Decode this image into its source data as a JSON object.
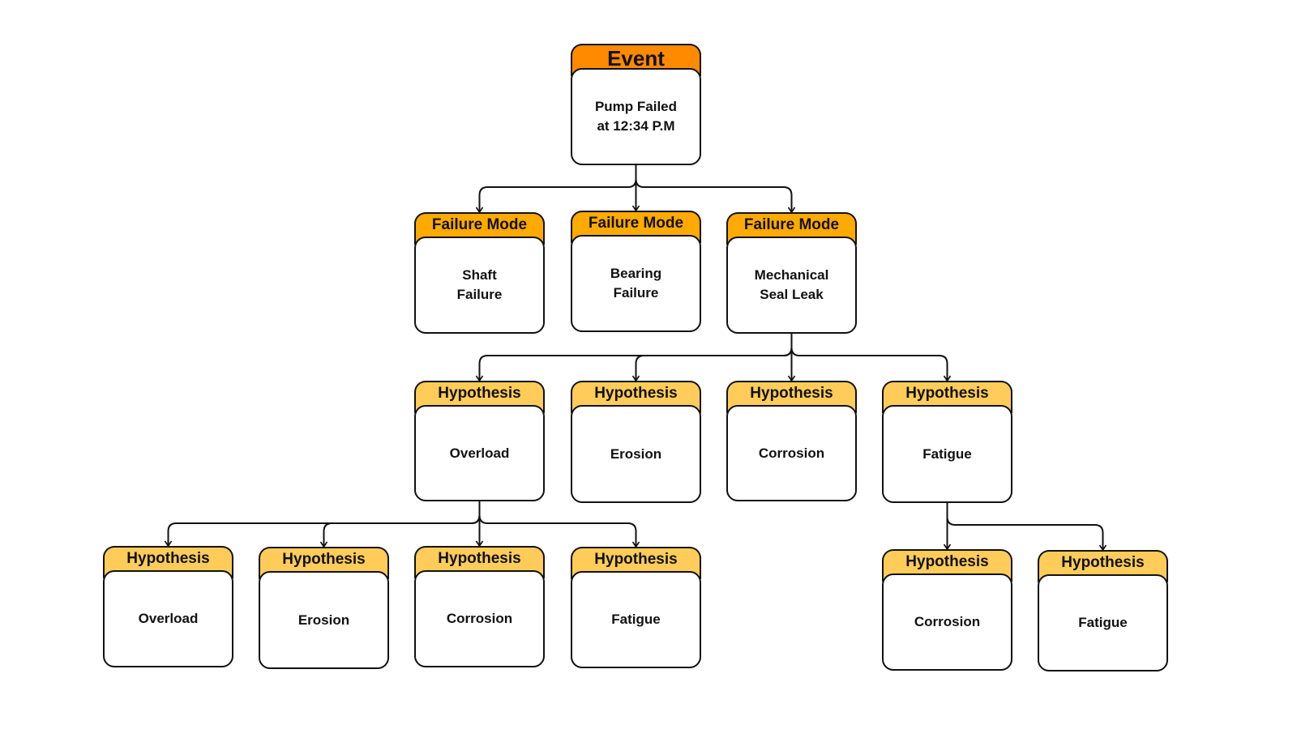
{
  "colors": {
    "event": "#ff8a00",
    "failure_mode": "#ffaa00",
    "hypothesis": "#ffcc5a",
    "line": "#111111"
  },
  "nodes": {
    "event": {
      "header": "Event",
      "text": "Pump Failed\nat 12:34 P.M"
    },
    "fm1": {
      "header": "Failure Mode",
      "text": "Shaft\nFailure"
    },
    "fm2": {
      "header": "Failure Mode",
      "text": "Bearing\nFailure"
    },
    "fm3": {
      "header": "Failure Mode",
      "text": "Mechanical\nSeal Leak"
    },
    "h1": {
      "header": "Hypothesis",
      "text": "Overload"
    },
    "h2": {
      "header": "Hypothesis",
      "text": "Erosion"
    },
    "h3": {
      "header": "Hypothesis",
      "text": "Corrosion"
    },
    "h4": {
      "header": "Hypothesis",
      "text": "Fatigue"
    },
    "h11": {
      "header": "Hypothesis",
      "text": "Overload"
    },
    "h12": {
      "header": "Hypothesis",
      "text": "Erosion"
    },
    "h13": {
      "header": "Hypothesis",
      "text": "Corrosion"
    },
    "h14": {
      "header": "Hypothesis",
      "text": "Fatigue"
    },
    "h41": {
      "header": "Hypothesis",
      "text": "Corrosion"
    },
    "h42": {
      "header": "Hypothesis",
      "text": "Fatigue"
    }
  },
  "edges": [
    [
      "event",
      "fm1"
    ],
    [
      "event",
      "fm2"
    ],
    [
      "event",
      "fm3"
    ],
    [
      "fm3",
      "h1"
    ],
    [
      "fm3",
      "h2"
    ],
    [
      "fm3",
      "h3"
    ],
    [
      "fm3",
      "h4"
    ],
    [
      "h1",
      "h11"
    ],
    [
      "h1",
      "h12"
    ],
    [
      "h1",
      "h13"
    ],
    [
      "h1",
      "h14"
    ],
    [
      "h4",
      "h41"
    ],
    [
      "h4",
      "h42"
    ]
  ]
}
